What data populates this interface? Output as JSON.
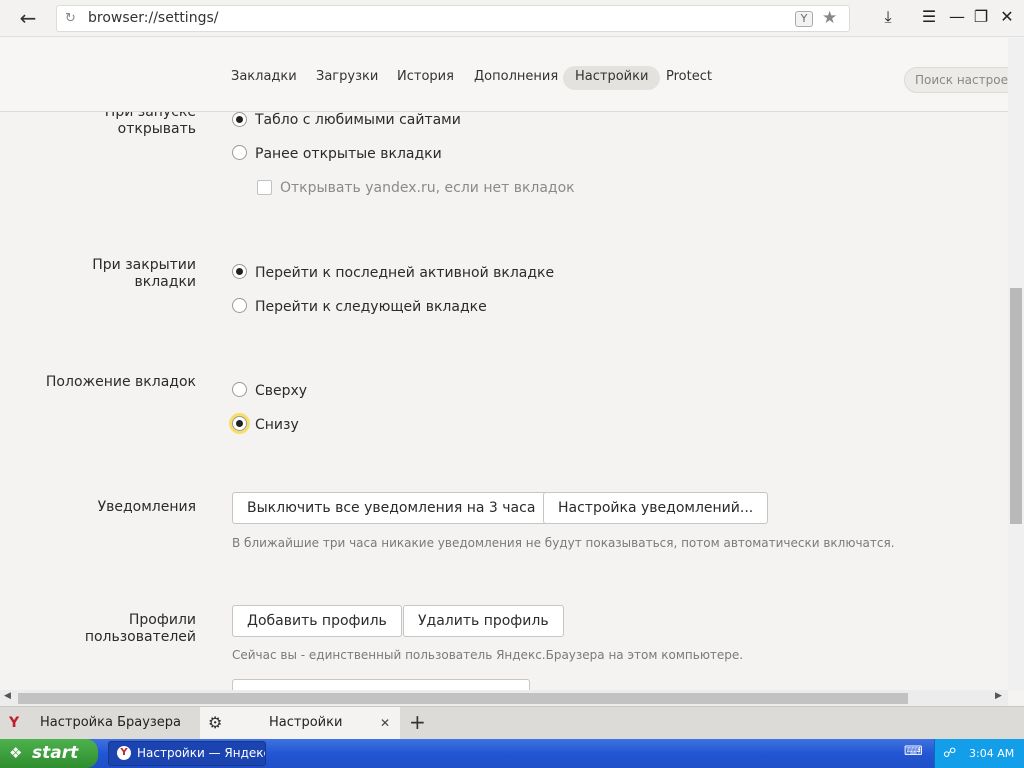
{
  "toolbar": {
    "url": "browser://settings/",
    "ybadge": "Y"
  },
  "nav": {
    "tabs": [
      {
        "label": "Закладки"
      },
      {
        "label": "Загрузки"
      },
      {
        "label": "История"
      },
      {
        "label": "Дополнения"
      },
      {
        "label": "Настройки",
        "active": true
      },
      {
        "label": "Protect"
      }
    ],
    "search_placeholder": "Поиск настроек"
  },
  "settings": {
    "startup": {
      "label_line1": "При запуске",
      "label_line2": "открывать",
      "option1": "Табло с любимыми сайтами",
      "option2": "Ранее открытые вкладки",
      "sub_option": "Открывать yandex.ru, если нет вкладок"
    },
    "closing": {
      "label_line1": "При закрытии",
      "label_line2": "вкладки",
      "option1": "Перейти к последней активной вкладке",
      "option2": "Перейти к следующей вкладке"
    },
    "tab_position": {
      "label": "Положение вкладок",
      "option1": "Сверху",
      "option2": "Снизу"
    },
    "notifications": {
      "label": "Уведомления",
      "button1": "Выключить все уведомления на 3 часа",
      "button2": "Настройка уведомлений...",
      "note": "В ближайшие три часа никакие уведомления не будут показываться, потом автоматически включатся."
    },
    "profiles": {
      "label_line1": "Профили",
      "label_line2": "пользователей",
      "button1": "Добавить профиль",
      "button2": "Удалить профиль",
      "note": "Сейчас вы - единственный пользователь Яндекс.Браузера на этом компьютере."
    }
  },
  "tabstrip": {
    "tab1": "Настройка Браузера",
    "tab2": "Настройки"
  },
  "taskbar": {
    "start": "start",
    "item": "Настройки — Яндекс...",
    "time": "3:04 AM"
  }
}
